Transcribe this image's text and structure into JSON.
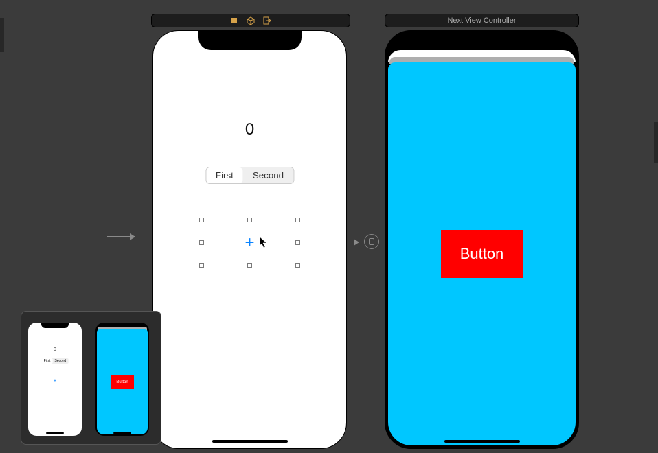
{
  "title_bars": {
    "right_label": "Next View Controller"
  },
  "scene1": {
    "counter_value": "0",
    "segmented": {
      "option1": "First",
      "option2": "Second"
    },
    "plus_label": "+"
  },
  "scene2": {
    "background_color": "#00c7ff",
    "button_label": "Button",
    "button_color": "#ff0000"
  },
  "minimap": {
    "counter": "0",
    "seg1": "First",
    "seg2": "Second",
    "button_label": "Button"
  },
  "colors": {
    "canvas_bg": "#3b3b3b",
    "accent_blue": "#0a84ff",
    "button_red": "#ff0000",
    "cyan": "#00c7ff"
  }
}
